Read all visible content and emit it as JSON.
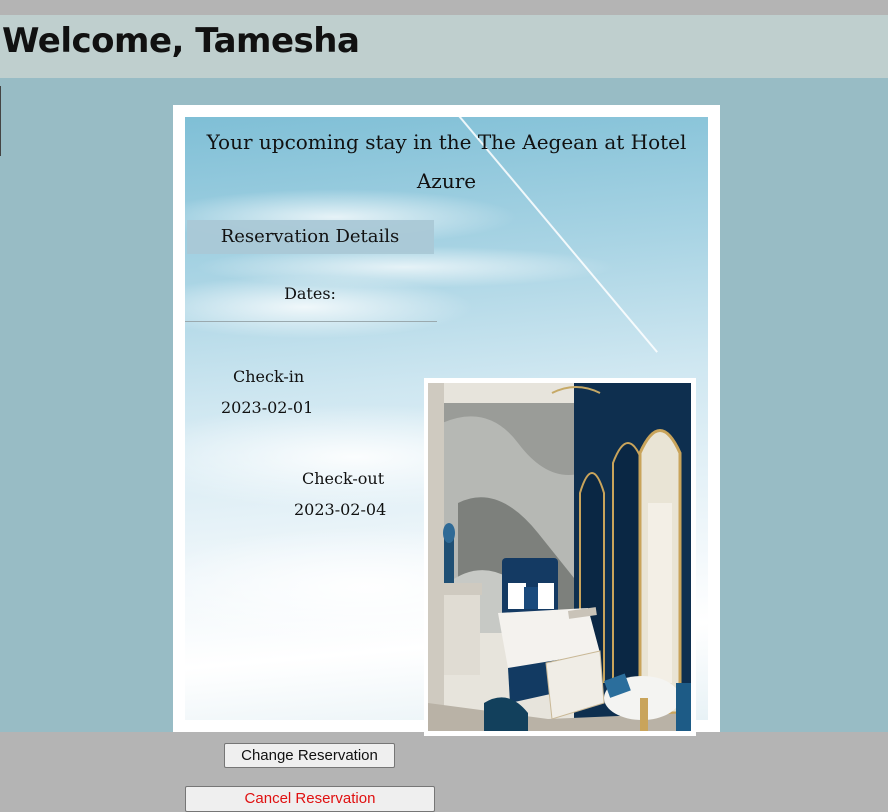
{
  "header": {
    "greeting": "Welcome, Tamesha"
  },
  "reservation": {
    "title": "Your upcoming stay in the The Aegean at Hotel Azure",
    "section_label": "Reservation Details",
    "dates_label": "Dates:",
    "check_in_label": "Check-in",
    "check_in_date": "2023-02-01",
    "check_out_label": "Check-out",
    "check_out_date": "2023-02-04"
  },
  "actions": {
    "change_label": "Change Reservation",
    "cancel_label": "Cancel Reservation"
  },
  "colors": {
    "header_bg": "#bfcfce",
    "page_bg": "#98bcc5",
    "cancel_text": "#e01010"
  }
}
